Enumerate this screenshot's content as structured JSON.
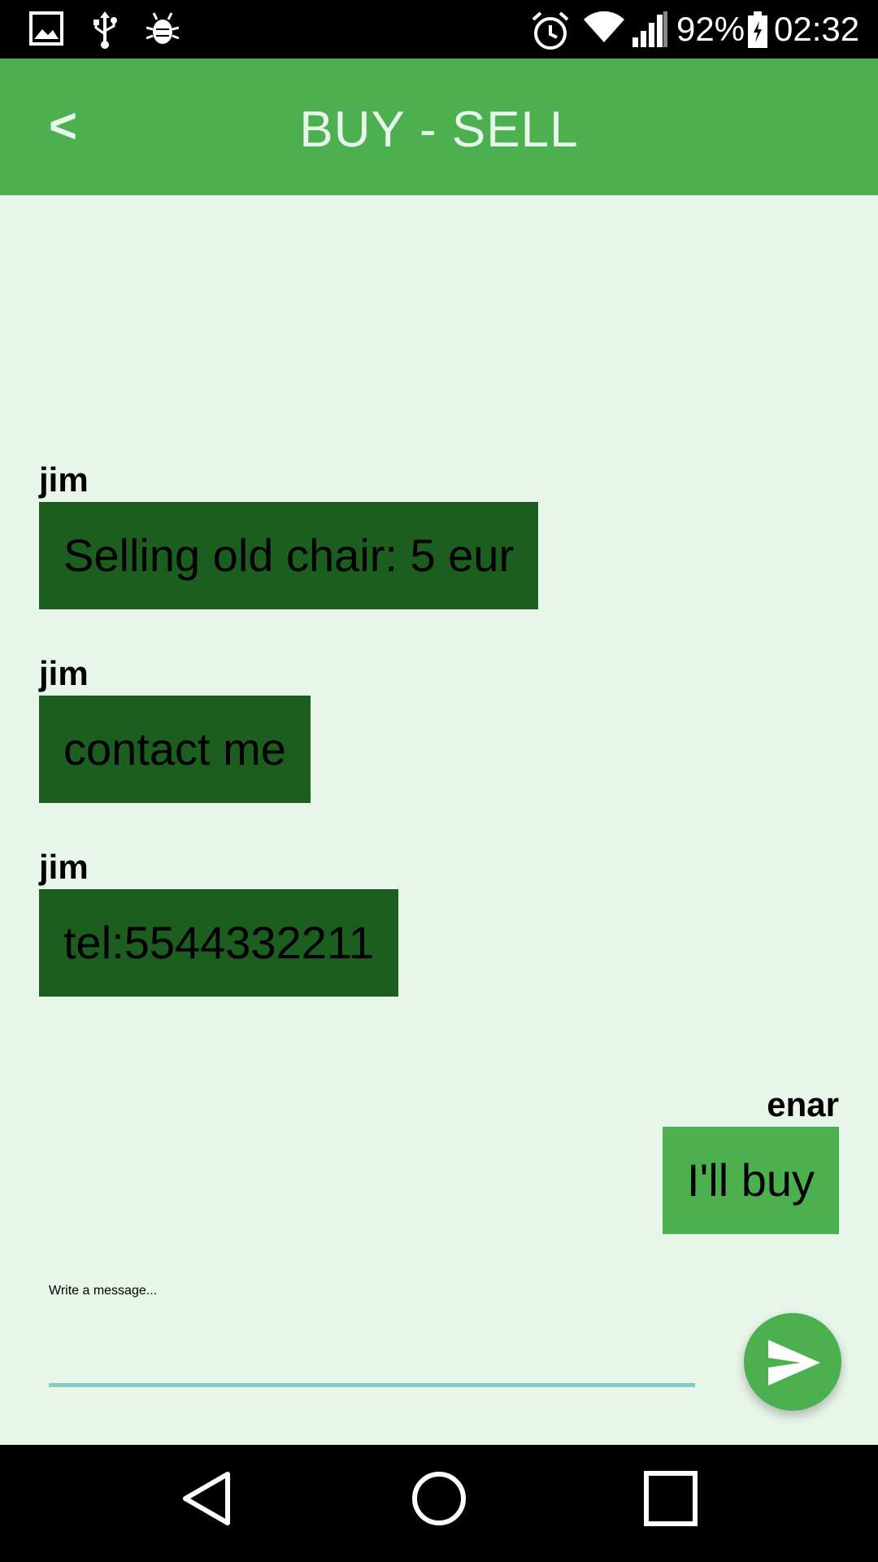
{
  "status_bar": {
    "icons": [
      "gallery-icon",
      "usb-icon",
      "bug-icon",
      "alarm-icon",
      "wifi-icon",
      "signal-icon",
      "battery-icon"
    ],
    "battery": "92%",
    "time": "02:32"
  },
  "header": {
    "back_label": "<",
    "title": "BUY - SELL"
  },
  "messages": [
    {
      "author": "jim",
      "text": "Selling old chair: 5 eur",
      "side": "left"
    },
    {
      "author": "jim",
      "text": "contact me",
      "side": "left"
    },
    {
      "author": "jim",
      "text": "tel:5544332211",
      "side": "left"
    },
    {
      "author": "enar",
      "text": "I'll buy",
      "side": "right"
    }
  ],
  "composer": {
    "hint": "Write a message...",
    "value": "",
    "send_icon": "send-icon"
  },
  "nav_bar": {
    "buttons": [
      "back-triangle-icon",
      "home-circle-icon",
      "recents-square-icon"
    ]
  },
  "colors": {
    "app_bar": "#4caf50",
    "background": "#e8f5e9",
    "bubble_other": "#1b5e20",
    "bubble_self": "#4caf50",
    "input_underline": "#80cbc4"
  }
}
